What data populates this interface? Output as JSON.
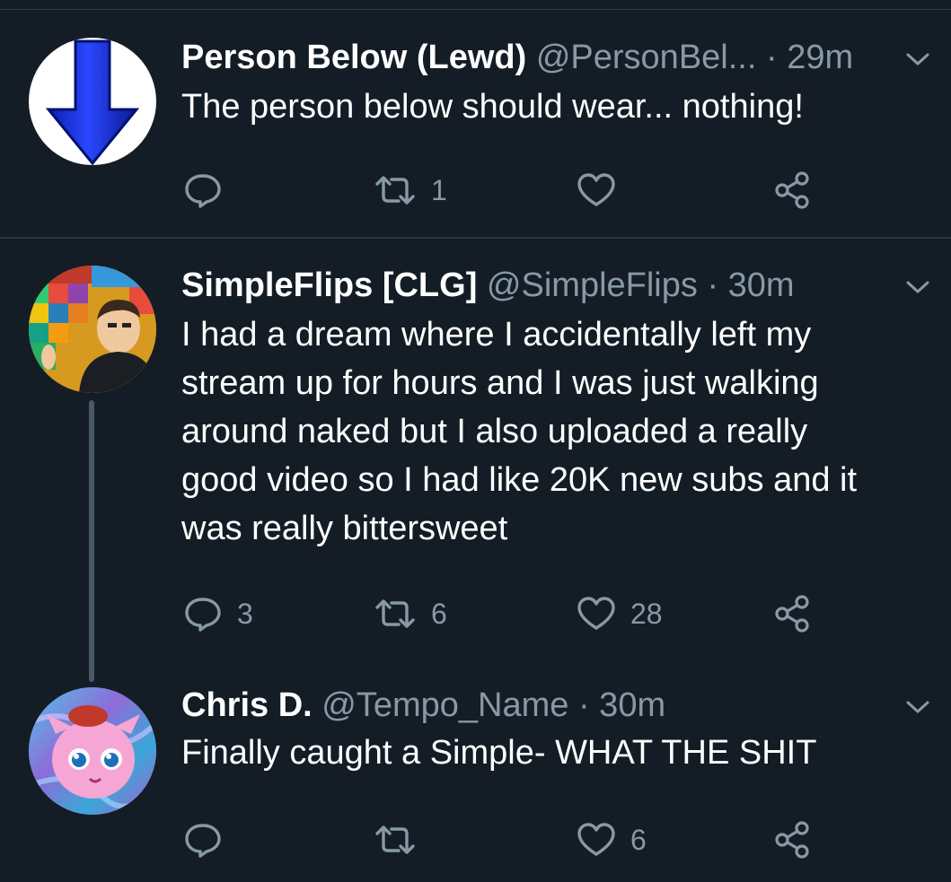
{
  "tweets": [
    {
      "name": "Person Below (Lewd)",
      "handle": "@PersonBel...",
      "time": "· 29m",
      "text": "The person below should wear... nothing!",
      "replies": "",
      "retweets": "1",
      "likes": ""
    },
    {
      "name": "SimpleFlips [CLG]",
      "handle": "@SimpleFlips",
      "time": "· 30m",
      "text": "I had a dream where I accidentally left my\nstream up for hours and I was just walking\naround naked but I also uploaded a really\ngood video so I had like 20K new subs and it\nwas really bittersweet",
      "replies": "3",
      "retweets": "6",
      "likes": "28"
    },
    {
      "name": "Chris D.",
      "handle": "@Tempo_Name",
      "time": "· 30m",
      "text": "Finally caught a Simple- WHAT THE SHIT",
      "replies": "",
      "retweets": "",
      "likes": "6"
    }
  ],
  "colors": {
    "background": "#141d26",
    "secondary_text": "#8899a6",
    "divider": "#2a3541"
  }
}
